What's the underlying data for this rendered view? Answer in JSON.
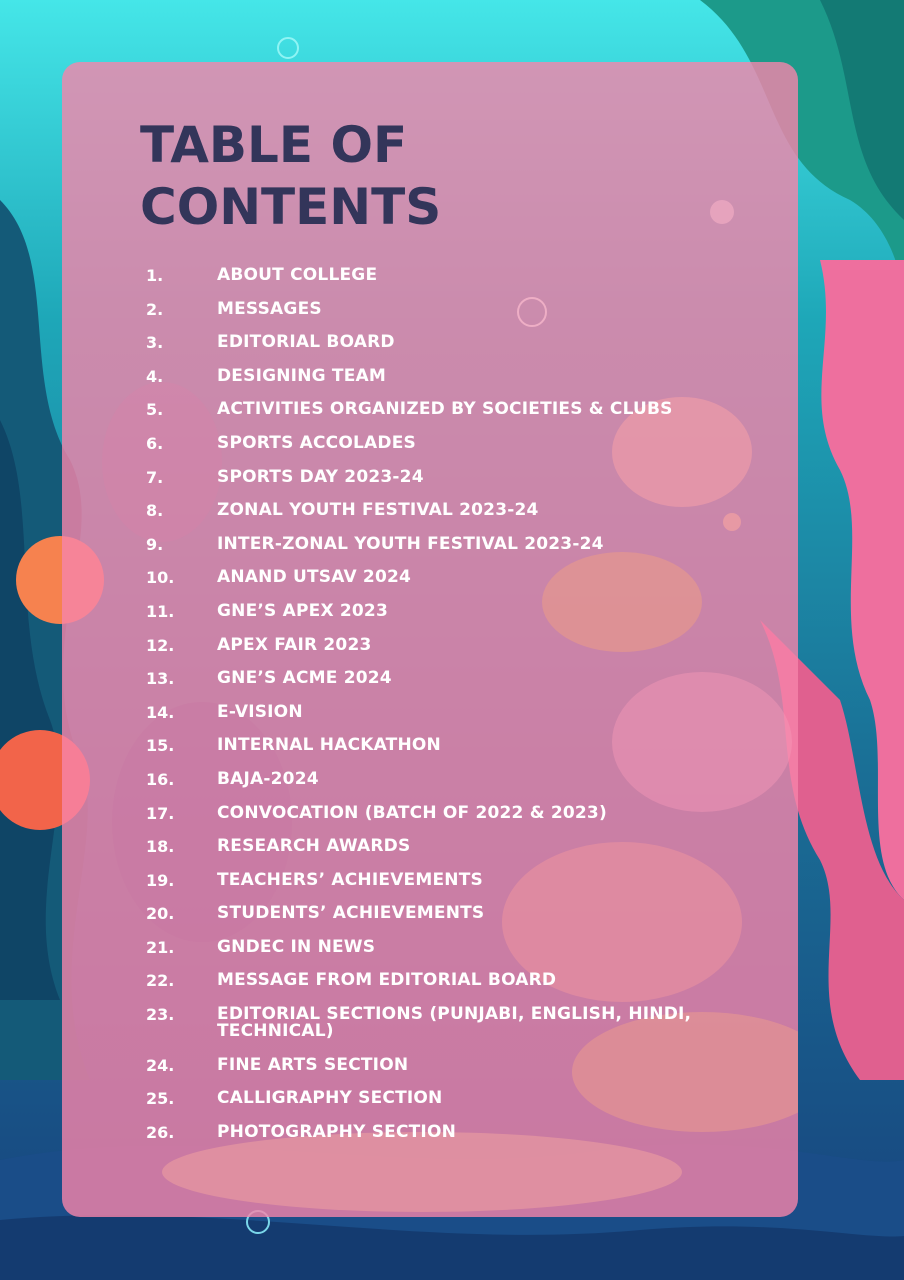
{
  "toc": {
    "title_line1": "TABLE OF",
    "title_line2": "CONTENTS",
    "items": [
      {
        "num": "1.",
        "label": "ABOUT COLLEGE"
      },
      {
        "num": "2.",
        "label": "MESSAGES"
      },
      {
        "num": "3.",
        "label": "EDITORIAL BOARD"
      },
      {
        "num": "4.",
        "label": "DESIGNING TEAM"
      },
      {
        "num": "5.",
        "label": "ACTIVITIES ORGANIZED BY SOCIETIES & CLUBS"
      },
      {
        "num": "6.",
        "label": "SPORTS ACCOLADES"
      },
      {
        "num": "7.",
        "label": "SPORTS DAY 2023-24"
      },
      {
        "num": "8.",
        "label": "ZONAL YOUTH FESTIVAL 2023-24"
      },
      {
        "num": "9.",
        "label": "INTER-ZONAL YOUTH FESTIVAL 2023-24"
      },
      {
        "num": "10.",
        "label": "ANAND UTSAV 2024"
      },
      {
        "num": "11.",
        "label": "GNE’S APEX 2023"
      },
      {
        "num": "12.",
        "label": "APEX FAIR 2023"
      },
      {
        "num": "13.",
        "label": "GNE’S ACME 2024"
      },
      {
        "num": "14.",
        "label": "E-VISION"
      },
      {
        "num": "15.",
        "label": "INTERNAL HACKATHON"
      },
      {
        "num": "16.",
        "label": "BAJA-2024"
      },
      {
        "num": "17.",
        "label": "CONVOCATION (BATCH OF 2022 & 2023)"
      },
      {
        "num": "18.",
        "label": "RESEARCH AWARDS"
      },
      {
        "num": "19.",
        "label": "TEACHERS’ ACHIEVEMENTS"
      },
      {
        "num": "20.",
        "label": "STUDENTS’ ACHIEVEMENTS"
      },
      {
        "num": "21.",
        "label": "GNDEC IN NEWS"
      },
      {
        "num": "22.",
        "label": "MESSAGE FROM EDITORIAL BOARD"
      },
      {
        "num": "23.",
        "label": "EDITORIAL SECTIONS (PUNJABI, ENGLISH, HINDI, TECHNICAL)"
      },
      {
        "num": "24.",
        "label": "FINE ARTS SECTION"
      },
      {
        "num": "25.",
        "label": "CALLIGRAPHY SECTION"
      },
      {
        "num": "26.",
        "label": "PHOTOGRAPHY SECTION"
      }
    ]
  },
  "colors": {
    "title": "#33355a",
    "panel": "#f684aa",
    "item_text": "#ffffff",
    "water_top": "#3fe0e6",
    "water_bottom": "#1b4f86"
  }
}
